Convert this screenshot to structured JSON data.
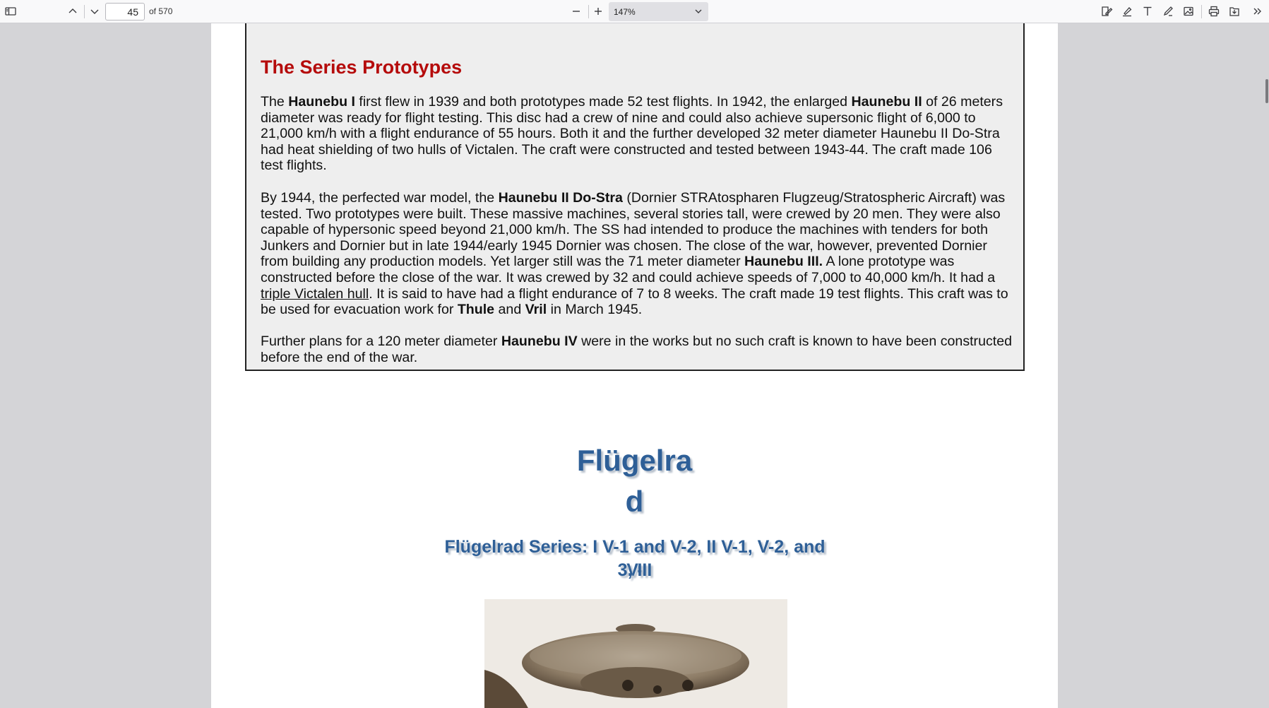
{
  "toolbar": {
    "page_number": "45",
    "page_count": "of 570",
    "zoom_value": "147%"
  },
  "document": {
    "section_title": "The Series Prototypes",
    "p1": {
      "t1": "The ",
      "b1": "Haunebu I",
      "t2": " first flew in 1939 and both prototypes made 52 test flights. In 1942, the enlarged ",
      "b2": "Haunebu II",
      "t3": " of 26 meters diameter was ready for flight testing. This disc had a crew of nine and could also achieve supersonic flight of 6,000 to 21,000 km/h with a flight endurance of 55 hours. Both it and the further developed 32 meter diameter Haunebu II Do-Stra had heat shielding of two hulls of Victalen. The craft were constructed and tested between 1943-44. The craft made 106 test flights."
    },
    "p2": {
      "t1": "By 1944, the perfected war model, the ",
      "b1": "Haunebu II Do-Stra",
      "t2": " (Dornier STRAtospharen Flugzeug/Stratospheric Aircraft) was tested. Two prototypes were built. These massive machines, several stories tall, were crewed by 20 men. They were also capable of hypersonic speed beyond 21,000 km/h. The SS had intended to produce the machines with tenders for both Junkers and Dornier but in late 1944/early 1945 Dornier was chosen. The close of the war, however, prevented Dornier from building any production models. Yet larger still was the 71 meter diameter ",
      "b2": "Haunebu III.",
      "t3": " A lone prototype was constructed before the close of the war. It was crewed by 32 and could achieve speeds of 7,000 to 40,000 km/h. It had a ",
      "u1": "triple Victalen hull",
      "t4": ". It is said to have had a flight endurance of 7 to 8 weeks. The craft made 19 test flights. This craft was to be used for evacuation work for ",
      "b3": "Thule",
      "t5": " and ",
      "b4": "Vril",
      "t6": " in March 1945."
    },
    "p3": {
      "t1": "Further plans for a 120 meter diameter ",
      "b1": "Haunebu IV",
      "t2": " were in the works but no such craft is known to have been constructed before the end of the war."
    },
    "heading_line1": "Flügelra",
    "heading_line2": "d",
    "subheading_line1": "Flügelrad Series: I V-1 and V-2, II V-1, V-2, and V-",
    "subheading_line2": "3, III"
  },
  "icons": {
    "sidebar": "sidebar-toggle-icon",
    "prev": "chevron-up-icon",
    "next": "chevron-down-icon",
    "zoom_out": "minus-icon",
    "zoom_in": "plus-icon",
    "form": "form-fill-icon",
    "highlight": "highlight-icon",
    "text": "text-tool-icon",
    "draw": "draw-icon",
    "image": "image-icon",
    "print": "print-icon",
    "save": "save-icon",
    "more": "more-tools-icon"
  },
  "colors": {
    "section_title": "#b50b0b",
    "heading": "#2e5f97",
    "toolbar_bg": "#f9f9fa",
    "viewer_bg": "#d4d4d7"
  }
}
